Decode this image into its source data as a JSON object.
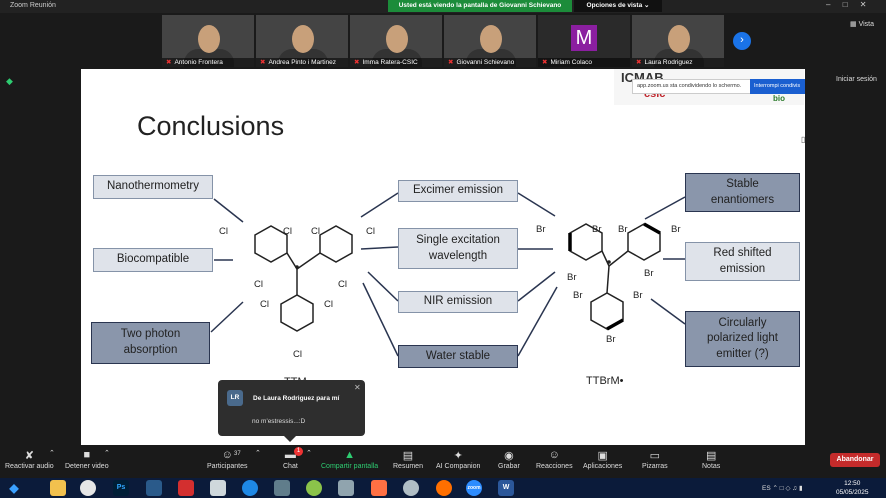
{
  "window": {
    "title": "Zoom Reunión",
    "share_banner": "Usted está viendo la pantalla de Giovanni Schievano",
    "view_options": "Opciones de vista",
    "controls": [
      "–",
      "□",
      "✕"
    ],
    "vista": "Vista",
    "signin": "Iniciar sesión"
  },
  "participants": [
    {
      "name": "Antonio Frontera",
      "kind": "video"
    },
    {
      "name": "Andrea Pinto i Martinez",
      "kind": "video"
    },
    {
      "name": "Imma Ratera-CSIC",
      "kind": "video"
    },
    {
      "name": "Giovanni Schievano",
      "kind": "video"
    },
    {
      "name": "Miriam Colaco",
      "kind": "letter",
      "letter": "M"
    },
    {
      "name": "Laura Rodriguez",
      "kind": "video"
    }
  ],
  "slide": {
    "title": "Conclusions",
    "logo_text": "ICMAB",
    "logo_text2": "csic",
    "logo_text3": "bio",
    "notice": "app.zoom.us sta condividendo lo schermo.",
    "notice_button": "Interrompi condivis",
    "left_boxes": [
      "Nanothermometry",
      "Biocompatible",
      "Two photon absorption"
    ],
    "center_boxes": [
      "Excimer emission",
      "Single excitation wavelength",
      "NIR emission",
      "Water stable"
    ],
    "right_boxes": [
      "Stable enantiomers",
      "Red shifted emission",
      "Circularly polarized light emitter (?)"
    ],
    "ttm_caption": "TTM•",
    "ttbrm_caption": "TTBrM•",
    "cl": "Cl",
    "br": "Br"
  },
  "chat_notification": {
    "avatar": "LR",
    "from": "De Laura Rodriguez para mí",
    "message": "no m'estressis...:D"
  },
  "toolbar": {
    "audio": "Reactivar audio",
    "video": "Detener video",
    "participants": "Participantes",
    "participants_count": "37",
    "chat": "Chat",
    "chat_badge": "1",
    "share": "Compartir pantalla",
    "summary": "Resumen",
    "ai": "AI Companion",
    "record": "Grabar",
    "reactions": "Reacciones",
    "apps": "Aplicaciones",
    "whiteboards": "Pizarras",
    "notes": "Notas",
    "leave": "Abandonar"
  },
  "taskbar": {
    "lang": "ES",
    "time": "12:50",
    "date": "05/05/2025",
    "zoom_label": "zoom",
    "ps_label": "Ps"
  },
  "colors": {
    "share_green": "#1c8c3a",
    "leave_red": "#c42b2b",
    "box_light": "#dfe3ea",
    "box_dark": "#8a96ab"
  }
}
